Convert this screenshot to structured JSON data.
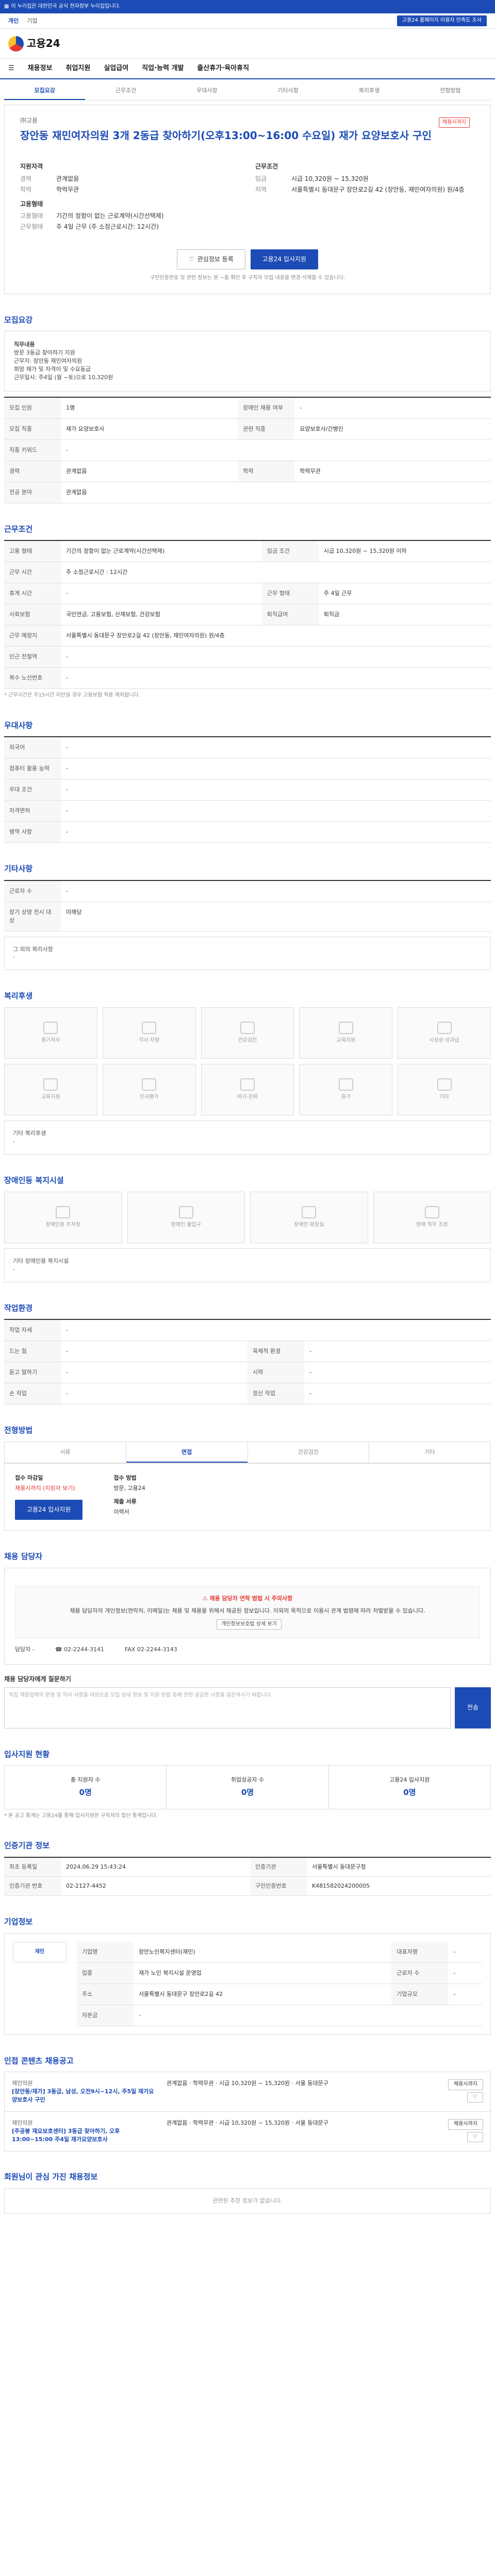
{
  "topbar": {
    "notice": "이 누리집은 대한민국 공식 전자정부 누리집입니다.",
    "right": "고용24 홈페이지 이용자 만족도 조사"
  },
  "subbar": {
    "items": [
      "개인",
      "기업"
    ],
    "promo": "고용24 홈페이지 이용자 만족도 조사"
  },
  "header": {
    "logo": "고용24"
  },
  "gnb": {
    "items": [
      "채용정보",
      "취업지원",
      "실업급여",
      "직업·능력 개발",
      "출산휴가·육아휴직"
    ]
  },
  "tabs": [
    "모집요강",
    "근무조건",
    "우대사항",
    "기타사항",
    "복리후생",
    "전형방법"
  ],
  "title": {
    "company": "㈜고용",
    "job": "장안동 재민여자의원 3개 2동급 찾아하기(오후13:00~16:00 수요일) 재가 요양보호사 구인",
    "badge": "채용시까지"
  },
  "summary": {
    "left_head": "지원자격",
    "left": [
      {
        "k": "경력",
        "v": "관계없음"
      },
      {
        "k": "학력",
        "v": "학력무관"
      }
    ],
    "left2_head": "고용형태",
    "left2": [
      {
        "k": "고용형태",
        "v": "기간의 정함이 없는 근로계약(시간선택제)"
      },
      {
        "k": "근무형태",
        "v": "주 4일 근무 (주 소정근로시간: 12시간)"
      }
    ],
    "right_head": "근무조건",
    "right": [
      {
        "k": "임금",
        "v": "시급 10,320원 ~ 15,320원"
      },
      {
        "k": "지역",
        "v": "서울특별시 동대문구 장안로2길 42 (장안동, 재민여자의원) 원/4층"
      }
    ]
  },
  "actions": {
    "scrap": "관심정보 등록",
    "apply": "고용24 입사지원"
  },
  "note": "구인인증번호 및 관련 정보는 본 ~을 확인 후 구직자 모집 내용을 변경·삭제할 수 있습니다.",
  "recruit": {
    "heading": "모집요강",
    "intro_title": "직무내용",
    "intro": "방문 3동급 찾아하기 지원\n근무지: 장안동 재민여자의원\n희망 재가 및 자격이 및 수요동급\n근무일시: 주4일 (월 ~토)으로 10,320원",
    "rows": [
      [
        "모집 인원",
        "1명",
        "장애인 채용 여부",
        "-"
      ],
      [
        "모집 직종",
        "재가 요양보호사",
        "관련 직종",
        "요양보호사/간병인"
      ],
      [
        "직종 키워드",
        "-",
        "",
        ""
      ],
      [
        "경력",
        "관계없음",
        "학력",
        "학력무관"
      ],
      [
        "전공 분야",
        "관계없음",
        "",
        ""
      ]
    ]
  },
  "conditions": {
    "heading": "근무조건",
    "rows": [
      [
        "고용 형태",
        "기간의 정함이 없는 근로계약(시간선택제)",
        "임금 조건",
        "시급 10,320원 ~ 15,320원 이하"
      ],
      [
        "근무 시간",
        "주 소정근로시간 : 12시간",
        "",
        ""
      ],
      [
        "휴게 시간",
        "-",
        "근무 형태",
        "주 4일 근무"
      ],
      [
        "사회보험",
        "국민연금, 고용보험, 산재보험, 건강보험",
        "퇴직급여",
        "퇴직금"
      ],
      [
        "근무 예정지",
        "서울특별시 동대문구 장안로2길 42 (장안동, 재민여자의원) 원/4층",
        "",
        ""
      ],
      [
        "인근 전철역",
        "-",
        "",
        ""
      ],
      [
        "복수 노선번호",
        "-",
        "",
        ""
      ]
    ],
    "work_sched": "출퇴근 시간\n13시 00분 ~ 16시 00분",
    "fnote": "* 근무시간은 주15시간 미만일 경우 고용보험 적용 제외됩니다."
  },
  "prefer": {
    "heading": "우대사항",
    "rows": [
      [
        "외국어",
        "-"
      ],
      [
        "컴퓨터 활용 능력",
        "-"
      ],
      [
        "우대 조건",
        "-"
      ],
      [
        "자격면허",
        "-"
      ],
      [
        "병역 사항",
        "-"
      ]
    ]
  },
  "etc": {
    "heading": "기타사항",
    "rows": [
      [
        "근로자 수",
        "-"
      ],
      [
        "장기 상영 전시 대상",
        "미해당"
      ]
    ],
    "sub": "그 외의 복리사항",
    "sub_v": "-"
  },
  "welfare": {
    "heading": "복리후생",
    "items": [
      "종기처우",
      "각사·차량",
      "건강검진",
      "교육지원",
      "시상상·성과급",
      "교육지원",
      "인사평가",
      "여가·문화",
      "휴가",
      "기타"
    ],
    "etc_label": "기타 복리후생",
    "etc_v": "-"
  },
  "disabled": {
    "heading": "장애인등 복지시설",
    "items": [
      "장애인용 주차장",
      "장애인 출입구",
      "장애인 화장실",
      "장애 직무 조정"
    ],
    "etc_label": "기타 장애인용 복지시설",
    "etc_v": "-"
  },
  "workenv": {
    "heading": "작업환경",
    "rows": [
      [
        "작업 자세",
        "-",
        "",
        ""
      ],
      [
        "드는 힘",
        "-",
        "육체적 환경",
        "-"
      ],
      [
        "듣고 말하기",
        "-",
        "시력",
        "-"
      ],
      [
        "손 작업",
        "-",
        "정신 작업",
        "-"
      ]
    ]
  },
  "selection": {
    "heading": "전형방법",
    "tabs": [
      "서류",
      "면접",
      "건강검진",
      "기타"
    ],
    "deadline_label": "접수 마감일",
    "deadline": "채용시까지 (지원자 보기)",
    "method_label": "접수 방법",
    "method": "방문, 고용24",
    "docs_label": "제출 서류",
    "docs": "이력서",
    "apply_btn": "고용24 입사지원"
  },
  "contact": {
    "heading": "채용 담당자",
    "warn": "채용 담당자 연락 범법 시 주의사항",
    "warn_body": "채용 담당자의 개인정보(연락처, 이메일)는 채용 및 채용을 위해서 제공된 정보입니다. 이외의 목적으로 이용시 관계 법령에 따라 처벌받을 수 있습니다.",
    "warn_btn": "개인정보보호법 상세 보기",
    "name_label": "담당자",
    "name": "-",
    "tel": "02-2244-3141",
    "fax": "02-2244-3143",
    "qna_title": "채용 담당자에게 질문하기",
    "qna_placeholder": "직접 채용업체의 운영 및 의사 사항을 대상으로 모집 상세 정보 및 지원 방법 등에 관한 궁금한 사항을 질문하시기 바랍니다.",
    "qna_btn": "전송"
  },
  "stats": {
    "heading": "입사지원 현황",
    "items": [
      {
        "label": "총 지원자 수",
        "v": "0명"
      },
      {
        "label": "취업성공자 수",
        "v": "0명"
      },
      {
        "label": "고용24 입사지원",
        "v": "0명"
      }
    ],
    "fnote": "* 본 공고 통계는 고용24를 통해 입사지원한 구직자의 합산 통계입니다."
  },
  "register": {
    "heading": "인증기관 정보",
    "rows": [
      [
        "최초 등록일",
        "2024.06.29 15:43:24",
        "인증기관",
        "서울특별시 동대문구청"
      ],
      [
        "인증기관 번호",
        "02-2127-4452",
        "구인인증번호",
        "K481582024200005"
      ]
    ]
  },
  "company": {
    "heading": "기업정보",
    "name": "재민",
    "rows": [
      [
        "기업명",
        "장안노인복지센터(재민)",
        "대표자명",
        "-"
      ],
      [
        "업종",
        "재가 노인 복지시설 운영업",
        "근로자 수",
        "-"
      ],
      [
        "주소",
        "서울특별시 동대문구 장안로2길 42",
        "기업규모",
        "-"
      ],
      [
        "자본금",
        "-",
        "",
        ""
      ]
    ]
  },
  "similar": {
    "heading": "인접 콘텐츠 채용공고",
    "jobs": [
      {
        "cname": "재민의원",
        "title": "[장안동/재가] 3동급, 남성, 오전9시~12시, 주5일 재가요양보호사 구인",
        "meta": "관계없음 · 학력무관 · 시급 10,320원 ~ 15,320원 · 서울 동대문구",
        "d": "채용시까지"
      },
      {
        "cname": "재민의원",
        "title": "[주공봉 재요보호센터] 3동급 찾아하기, 오후13:00~15:00 주4일 재가요양보호사",
        "meta": "관계없음 · 학력무관 · 시급 10,320원 ~ 15,320원 · 서울 동대문구",
        "d": "채용시까지"
      }
    ]
  },
  "bottom": {
    "heading": "회원님이 관심 가진 채용정보",
    "empty": "관련된 추천 정보가 없습니다."
  }
}
